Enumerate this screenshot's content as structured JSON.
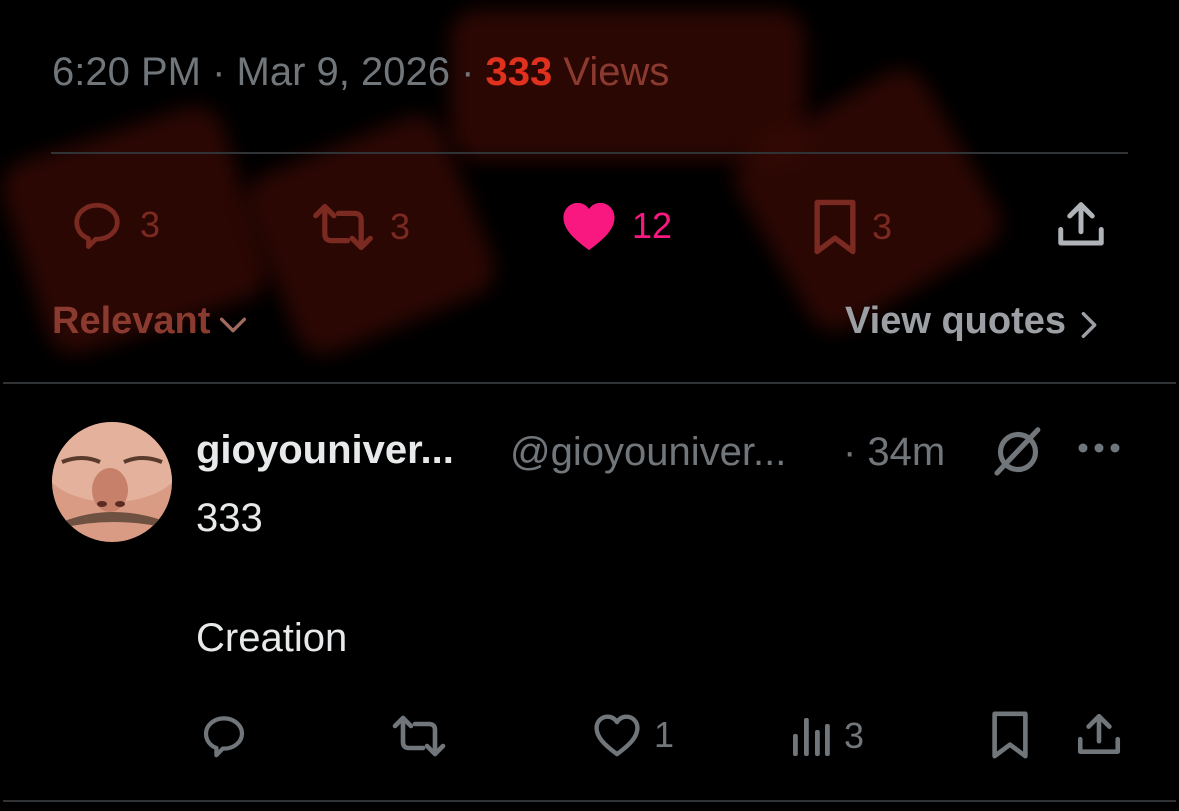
{
  "tweet_meta": {
    "time": "6:20 PM",
    "sep1": " · ",
    "date": "Mar 9, 2026",
    "sep2": " · ",
    "views_count": "333",
    "views_label": " Views"
  },
  "stats": {
    "replies": "3",
    "reposts": "3",
    "likes": "12",
    "bookmarks": "3"
  },
  "replies_sort": {
    "label": "Relevant",
    "view_quotes": "View quotes"
  },
  "reply": {
    "display_name": "gioyouniver...",
    "handle": "@gioyouniver...",
    "time": "· 34m",
    "line1": "333",
    "line2": "Creation",
    "likes": "1",
    "views": "3"
  },
  "colors": {
    "accent_like": "#f91880",
    "views_red": "#e0301e",
    "muted": "#71767b"
  }
}
